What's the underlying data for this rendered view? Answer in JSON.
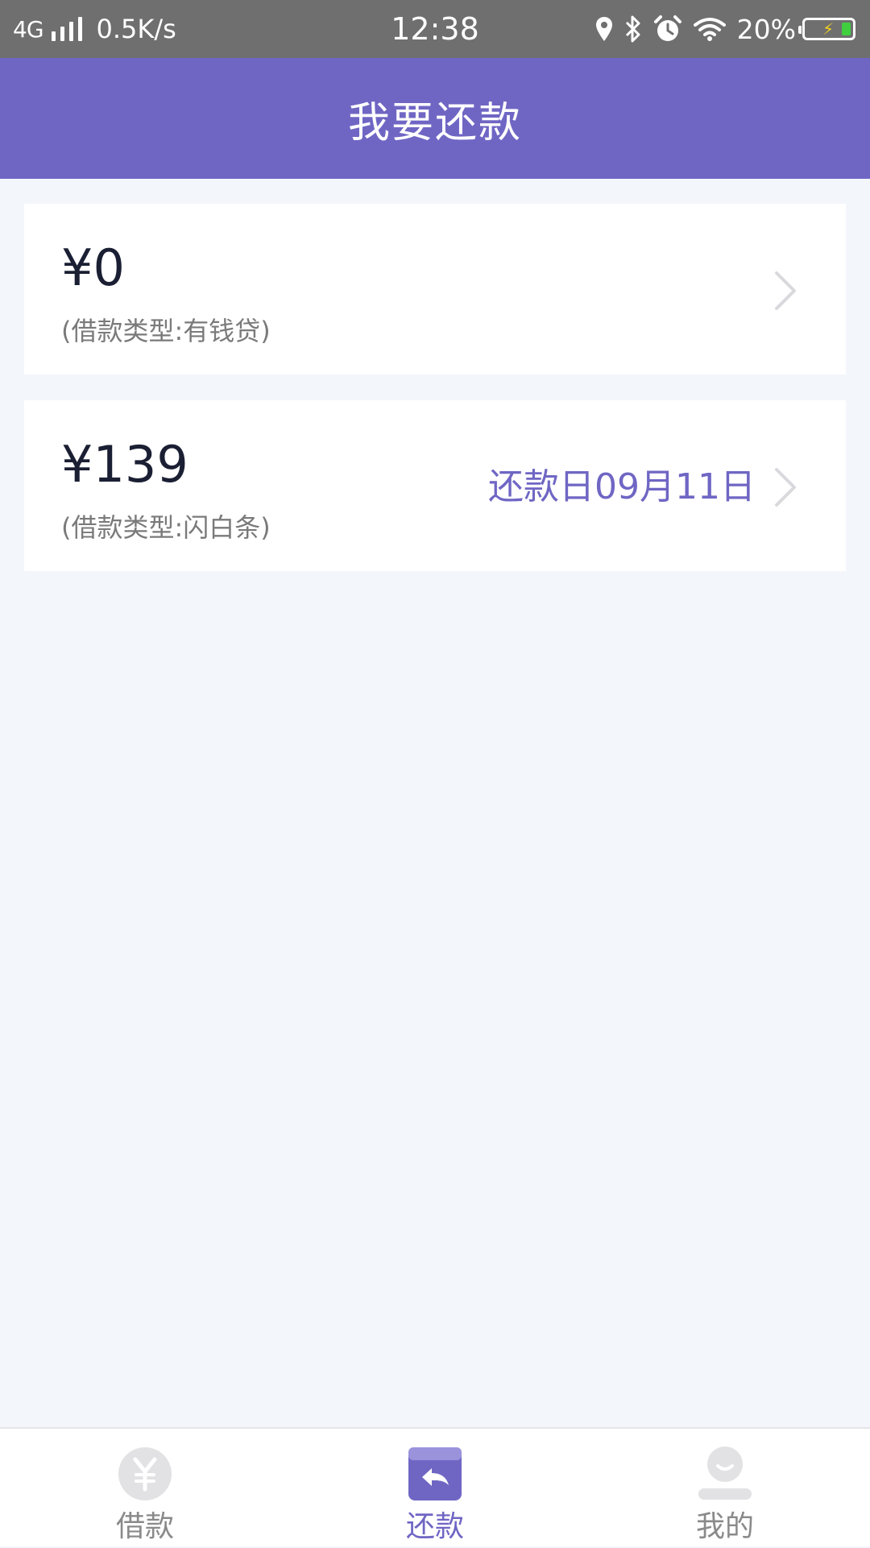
{
  "status_bar": {
    "network": "4G",
    "speed": "0.5K/s",
    "time": "12:38",
    "battery_percent": "20%",
    "battery_level": 0.2,
    "icons": [
      "signal-icon",
      "location-icon",
      "bluetooth-icon",
      "alarm-icon",
      "wifi-icon",
      "battery-icon",
      "charging-icon"
    ]
  },
  "header": {
    "title": "我要还款",
    "background": "#6f66c4"
  },
  "loans": [
    {
      "amount": "¥0",
      "type_label": "(借款类型:有钱贷)",
      "due": ""
    },
    {
      "amount": "¥139",
      "type_label": "(借款类型:闪白条)",
      "due": "还款日09月11日"
    }
  ],
  "tabbar": {
    "tabs": [
      {
        "label": "借款",
        "icon": "yen-coin-icon",
        "active": false
      },
      {
        "label": "还款",
        "icon": "repay-card-icon",
        "active": true
      },
      {
        "label": "我的",
        "icon": "profile-icon",
        "active": false
      }
    ]
  },
  "colors": {
    "accent": "#6f66c4",
    "page_background": "#f3f6fa",
    "status_bar": "#6f6f6f",
    "inactive_tab": "#8a8a8a"
  }
}
